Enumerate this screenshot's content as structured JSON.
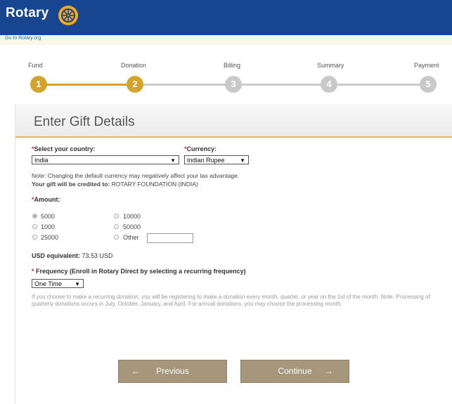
{
  "brand": {
    "name": "Rotary",
    "goto_link": "Go to Rotary.org"
  },
  "colors": {
    "brand_blue": "#17458f",
    "gold": "#d4a32b",
    "inactive_step": "#c9c9c9",
    "button_bg": "#a6967b"
  },
  "steps": [
    {
      "number": "1",
      "label": "Fund",
      "state": "done"
    },
    {
      "number": "2",
      "label": "Donation",
      "state": "active"
    },
    {
      "number": "3",
      "label": "Billing",
      "state": "pending"
    },
    {
      "number": "4",
      "label": "Summary",
      "state": "pending"
    },
    {
      "number": "5",
      "label": "Payment",
      "state": "pending"
    }
  ],
  "form": {
    "title": "Enter Gift Details",
    "country_label": "Select your country:",
    "country_value": "India",
    "currency_label": "Currency:",
    "currency_value": "Indian Rupee",
    "currency_note": "Note: Changing the default currency may negatively affect your tax advantage.",
    "credited_label": "Your gift will be credited to:",
    "credited_value": "ROTARY FOUNDATION (INDIA)",
    "amount_label": "Amount:",
    "amounts": [
      {
        "label": "5000",
        "selected": true
      },
      {
        "label": "10000",
        "selected": false
      },
      {
        "label": "1000",
        "selected": false
      },
      {
        "label": "50000",
        "selected": false
      },
      {
        "label": "25000",
        "selected": false
      },
      {
        "label": "Other",
        "selected": false
      }
    ],
    "other_value": "",
    "usd_label": "USD equivalent:",
    "usd_value": "73.53 USD",
    "frequency_label": "Frequency (Enroll in Rotary Direct by selecting a recurring frequency)",
    "frequency_value": "One Time",
    "frequency_note": "If you choose to make a recurring donation, you will be registering to make a donation every month, quarter, or year on the 1st of the month. Note: Processing of quarterly donations occurs in July, October, January, and April. For annual donations, you may choose the processing month."
  },
  "buttons": {
    "previous": "Previous",
    "continue": "Continue"
  }
}
